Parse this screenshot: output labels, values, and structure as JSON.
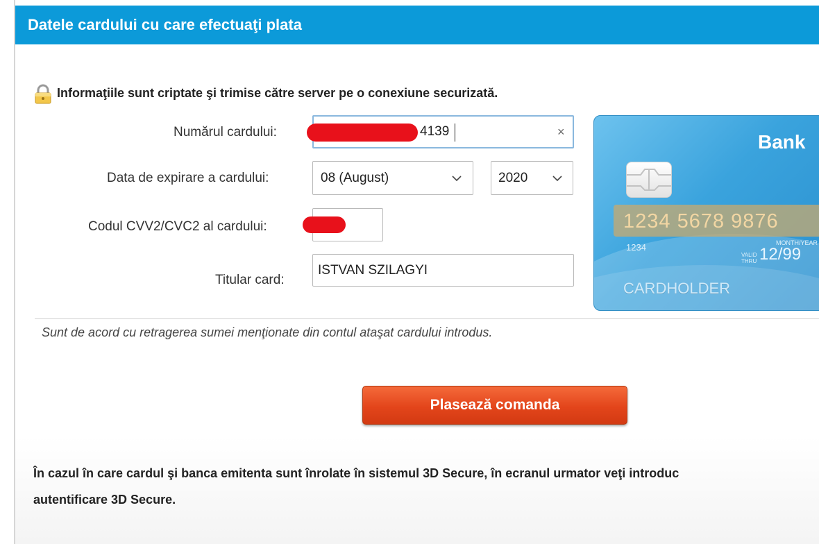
{
  "header": {
    "title": "Datele cardului cu care efectuaţi plata"
  },
  "security_note": "Informaţiile sunt criptate şi trimise către server pe o conexiune securizată.",
  "form": {
    "card_number": {
      "label": "Numărul cardului:",
      "value_visible": "4139",
      "clear_glyph": "×"
    },
    "expiry": {
      "label": "Data de expirare a cardului:",
      "month": "08 (August)",
      "year": "2020"
    },
    "cvv": {
      "label": "Codul CVV2/CVC2 al cardului:"
    },
    "holder": {
      "label": "Titular card:",
      "value": "ISTVAN SZILAGYI"
    }
  },
  "card_image": {
    "bank": "Bank",
    "number": "1234  5678  9876",
    "number_small": "1234",
    "valid_thru": "VALID\nTHRU",
    "month_year": "MONTH/YEAR",
    "expiry": "12/99",
    "cardholder": "CARDHOLDER"
  },
  "agreement": "Sunt de acord cu retragerea sumei menţionate din contul ataşat cardului introdus.",
  "submit_label": "Plasează comanda",
  "info_text": {
    "line1": "În cazul în care cardul şi banca emitenta sunt înrolate în sistemul 3D Secure, în ecranul urmator veţi introduc",
    "line2": "autentificare 3D Secure."
  },
  "colors": {
    "header_bg": "#0c9ad9",
    "button": "#e3451b",
    "redaction": "#e8111b"
  }
}
